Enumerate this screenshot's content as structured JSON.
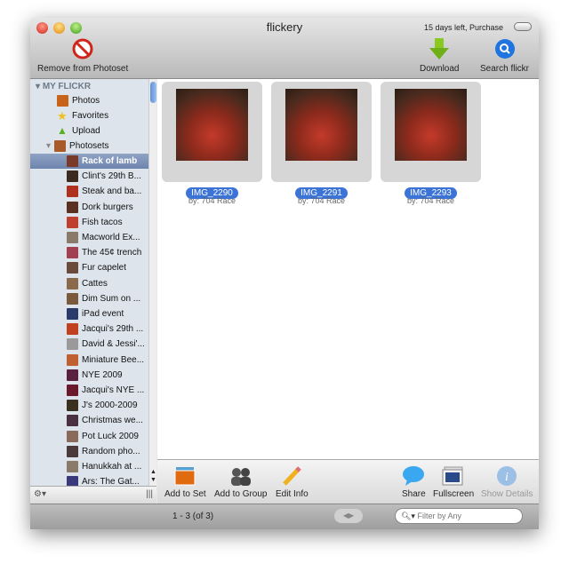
{
  "window": {
    "title": "flickery",
    "trial": "15 days left, Purchase"
  },
  "toolbar": {
    "remove": "Remove from Photoset",
    "download": "Download",
    "search": "Search flickr"
  },
  "sidebar": {
    "section": "MY FLICKR",
    "items": [
      {
        "label": "Photos"
      },
      {
        "label": "Favorites"
      },
      {
        "label": "Upload"
      },
      {
        "label": "Photosets"
      }
    ],
    "photosets": [
      "Rack of lamb",
      "Clint's 29th B...",
      "Steak and ba...",
      "Dork burgers",
      "Fish tacos",
      "Macworld Ex...",
      "The 45¢ trench",
      "Fur capelet",
      "Cattes",
      "Dim Sum on ...",
      "iPad event",
      "Jacqui's 29th ...",
      "David & Jessi'...",
      "Miniature Bee...",
      "NYE 2009",
      "Jacqui's NYE ...",
      "J's 2000-2009",
      "Christmas we...",
      "Pot Luck 2009",
      "Random pho...",
      "Hanukkah at ...",
      "Ars: The Gat..."
    ],
    "selected": "Rack of lamb"
  },
  "photos": [
    {
      "name": "IMG_2290",
      "by": "by: 704 Race"
    },
    {
      "name": "IMG_2291",
      "by": "by: 704 Race"
    },
    {
      "name": "IMG_2293",
      "by": "by: 704 Race"
    }
  ],
  "bottom_toolbar": {
    "add_to_set": "Add to Set",
    "add_to_group": "Add to Group",
    "edit_info": "Edit Info",
    "share": "Share",
    "fullscreen": "Fullscreen",
    "show_details": "Show Details"
  },
  "status": {
    "count": "1 - 3 (of 3)",
    "filter_placeholder": "Filter by Any"
  }
}
